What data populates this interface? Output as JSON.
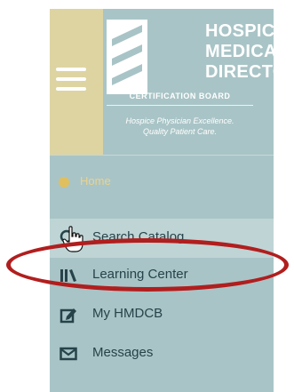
{
  "logo": {
    "line1": "HOSPICE",
    "line2": "MEDICAL",
    "line3": "DIRECTOR",
    "line4": "CERTIFICATION BOARD",
    "tagline1": "Hospice Physician Excellence.",
    "tagline2": "Quality Patient Care."
  },
  "home": {
    "label": "Home"
  },
  "nav": {
    "search": "Search Catalog",
    "learning": "Learning Center",
    "my": "My HMDCB",
    "messages": "Messages"
  },
  "colors": {
    "panel": "#a9c4c6",
    "menu_strip": "#ddd4a2",
    "highlight": "#b11e1e",
    "text": "#26434a"
  },
  "icons": [
    "hamburger-icon",
    "home-icon",
    "search-icon",
    "learning-center-icon",
    "edit-icon",
    "mail-icon",
    "hand-cursor-icon"
  ]
}
